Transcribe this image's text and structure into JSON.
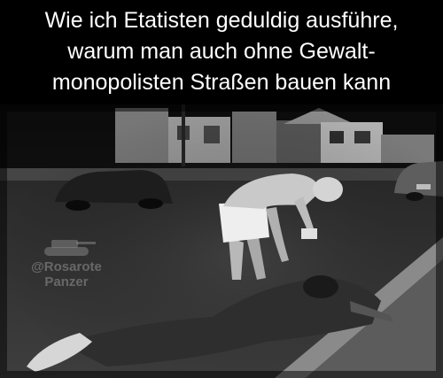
{
  "caption": {
    "lines": [
      "Wie ich Etatisten geduldig ausführe,",
      "warum man auch ohne Gewalt-",
      "monopolisten Straßen bauen kann"
    ]
  },
  "watermark": {
    "handle": "@Rosarote",
    "name": "Panzer",
    "icon": "tank-icon"
  },
  "photo": {
    "tone": "black-and-white night street scene"
  }
}
